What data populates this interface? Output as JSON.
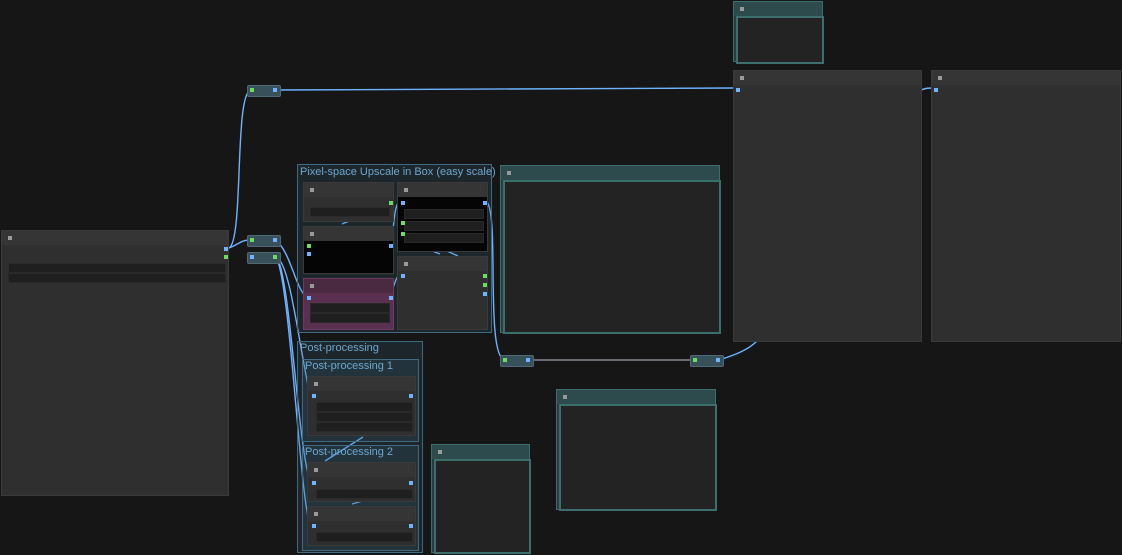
{
  "canvas": {
    "background": "#161616",
    "link_color": "#6eb3ff",
    "group_color": "#3f6a80"
  },
  "groups": {
    "upscale": {
      "title": "Pixel-space Upscale in Box (easy scale)"
    },
    "post": {
      "title": "Post-processing"
    },
    "post1": {
      "title": "Post-processing 1"
    },
    "post2": {
      "title": "Post-processing 2"
    }
  },
  "icons": {
    "node_collapse": "collapse-dot-icon",
    "port": "port-dot-icon"
  }
}
